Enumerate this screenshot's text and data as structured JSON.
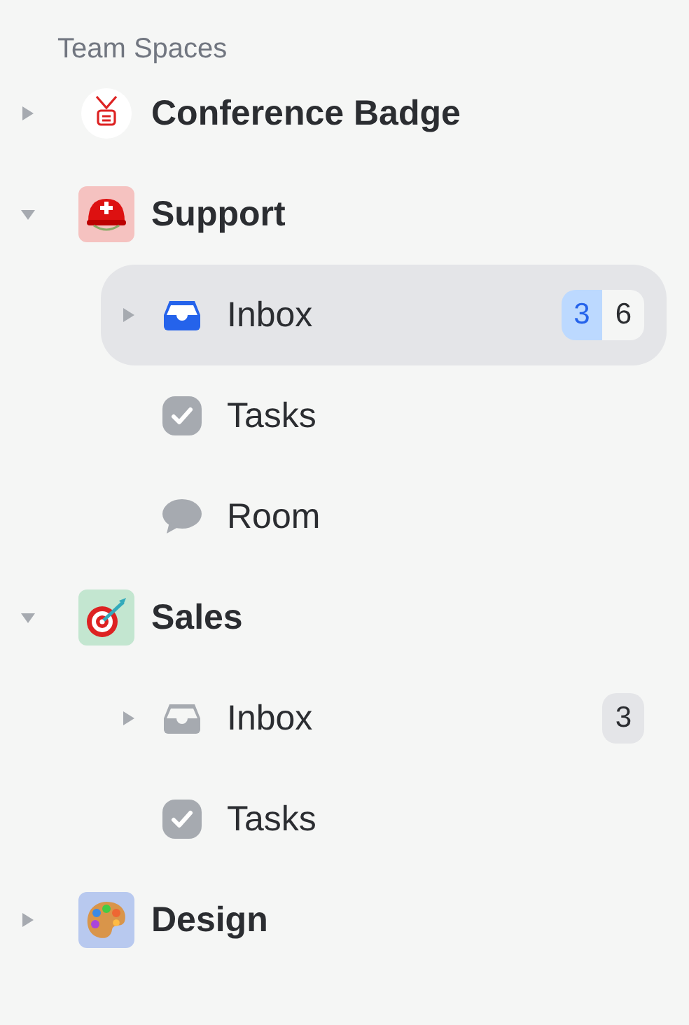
{
  "section_title": "Team Spaces",
  "spaces": [
    {
      "name": "Conference Badge",
      "expanded": false,
      "color": "#ffffff"
    },
    {
      "name": "Support",
      "expanded": true,
      "color": "#f5c2c0",
      "children": [
        {
          "kind": "inbox",
          "label": "Inbox",
          "selected": true,
          "expanded": false,
          "badges": [
            {
              "text": "3",
              "highlighted": true
            },
            {
              "text": "6",
              "highlighted": false
            }
          ]
        },
        {
          "kind": "tasks",
          "label": "Tasks",
          "selected": false
        },
        {
          "kind": "room",
          "label": "Room",
          "selected": false
        }
      ]
    },
    {
      "name": "Sales",
      "expanded": true,
      "color": "#c3e6d0",
      "children": [
        {
          "kind": "inbox",
          "label": "Inbox",
          "selected": false,
          "expanded": false,
          "badges": [
            {
              "text": "3",
              "highlighted": false
            }
          ]
        },
        {
          "kind": "tasks",
          "label": "Tasks",
          "selected": false
        }
      ]
    },
    {
      "name": "Design",
      "expanded": false,
      "color": "#b8c9ef"
    }
  ]
}
